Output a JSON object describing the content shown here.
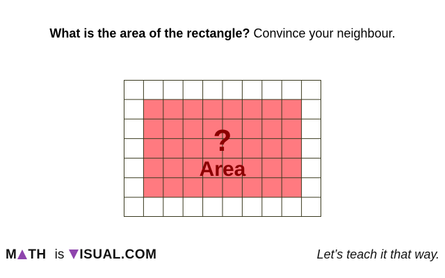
{
  "question": {
    "bold": "What is the area of the rectangle?",
    "normal": " Convince your neighbour."
  },
  "grid": {
    "cols": 10,
    "rows": 7,
    "shaded": {
      "col_start": 1,
      "col_end": 9,
      "row_start": 1,
      "row_end": 6
    },
    "fill_color": "#ff7a80",
    "grid_color": "#3a3a1f",
    "label_color": "#8b0000",
    "question_mark": "?",
    "area_label": "Area"
  },
  "footer": {
    "brand_m": "M",
    "brand_th": "TH",
    "brand_is": "is",
    "brand_isual": "ISUAL",
    "brand_com": ".COM",
    "accent_color": "#8e44ad",
    "tagline": "Let’s teach it that way."
  }
}
